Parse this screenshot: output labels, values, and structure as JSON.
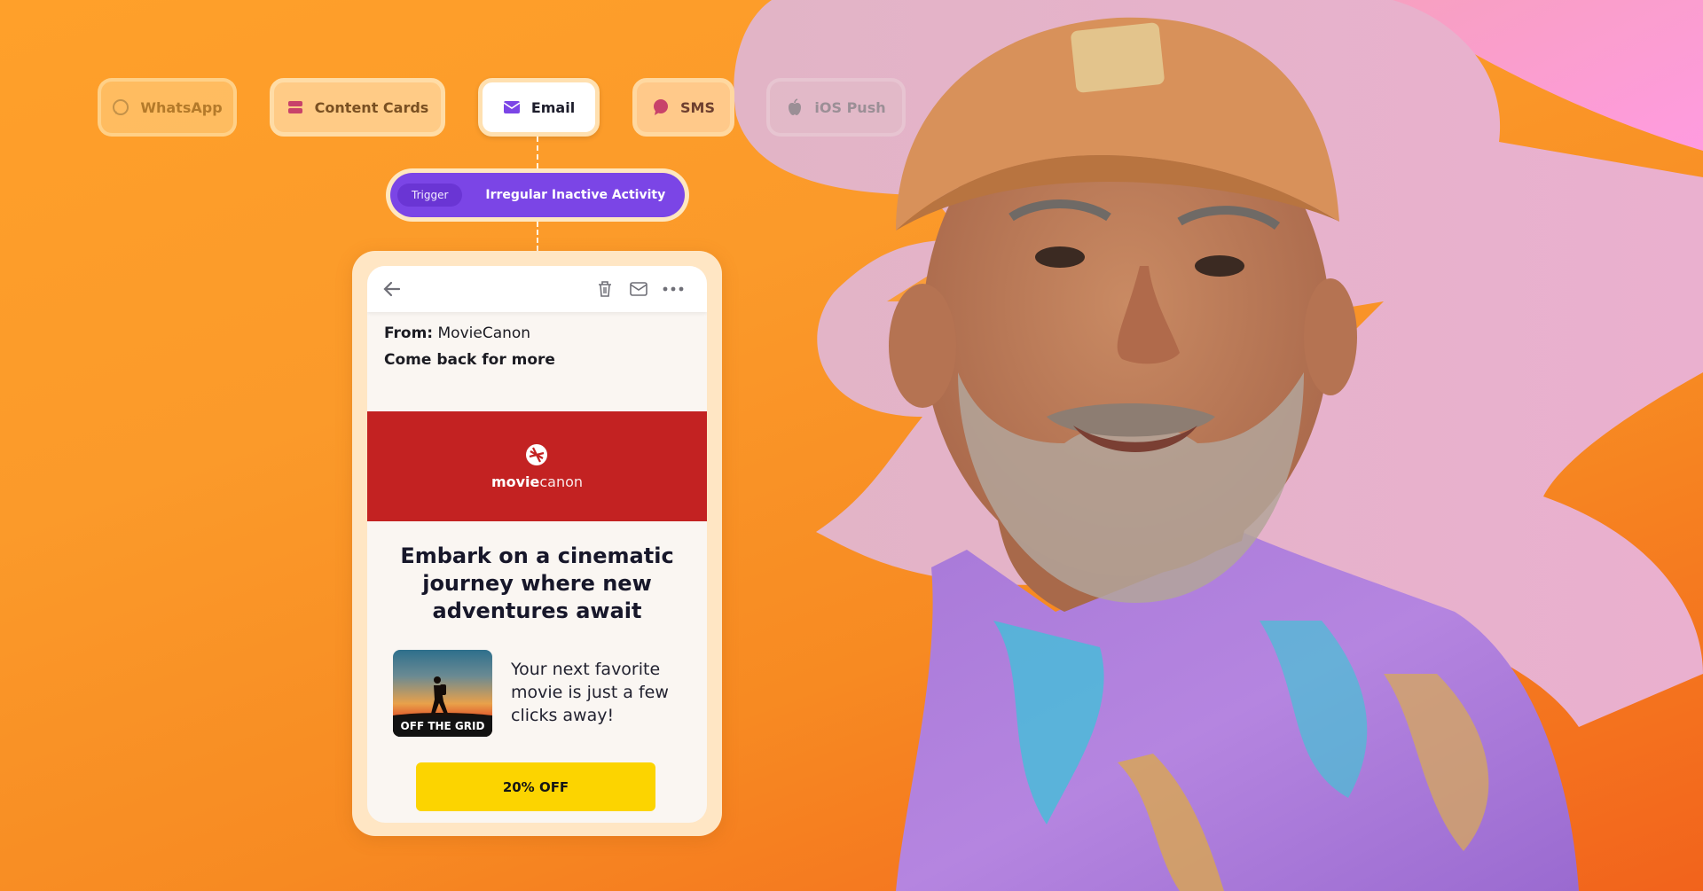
{
  "colors": {
    "background_orange": "#fb9a2a",
    "trigger_purple": "#7b45e6",
    "banner_red": "#c32222",
    "cta_yellow": "#fcd400",
    "shape_pink": "#e6b2c6"
  },
  "channels": [
    {
      "label": "WhatsApp",
      "icon": "whatsapp-icon",
      "state": "inactive"
    },
    {
      "label": "Content Cards",
      "icon": "content-cards-icon",
      "state": "inactive"
    },
    {
      "label": "Email",
      "icon": "envelope-icon",
      "state": "active"
    },
    {
      "label": "SMS",
      "icon": "chat-bubble-icon",
      "state": "inactive"
    },
    {
      "label": "iOS Push",
      "icon": "apple-icon",
      "state": "inactive"
    }
  ],
  "trigger": {
    "badge": "Trigger",
    "text": "Irregular Inactive Activity"
  },
  "email": {
    "toolbar_icons": [
      "back-arrow-icon",
      "trash-icon",
      "envelope-icon",
      "more-icon"
    ],
    "from_label": "From:",
    "from_value": "MovieCanon",
    "subject": "Come back for more",
    "brand_bold": "movie",
    "brand_light": "canon",
    "headline": "Embark on a cinematic journey where new adventures await",
    "thumbnail_caption": "OFF THE GRID",
    "promo_text": "Your next favorite movie is just a few clicks away!",
    "cta_label": "20% OFF"
  }
}
